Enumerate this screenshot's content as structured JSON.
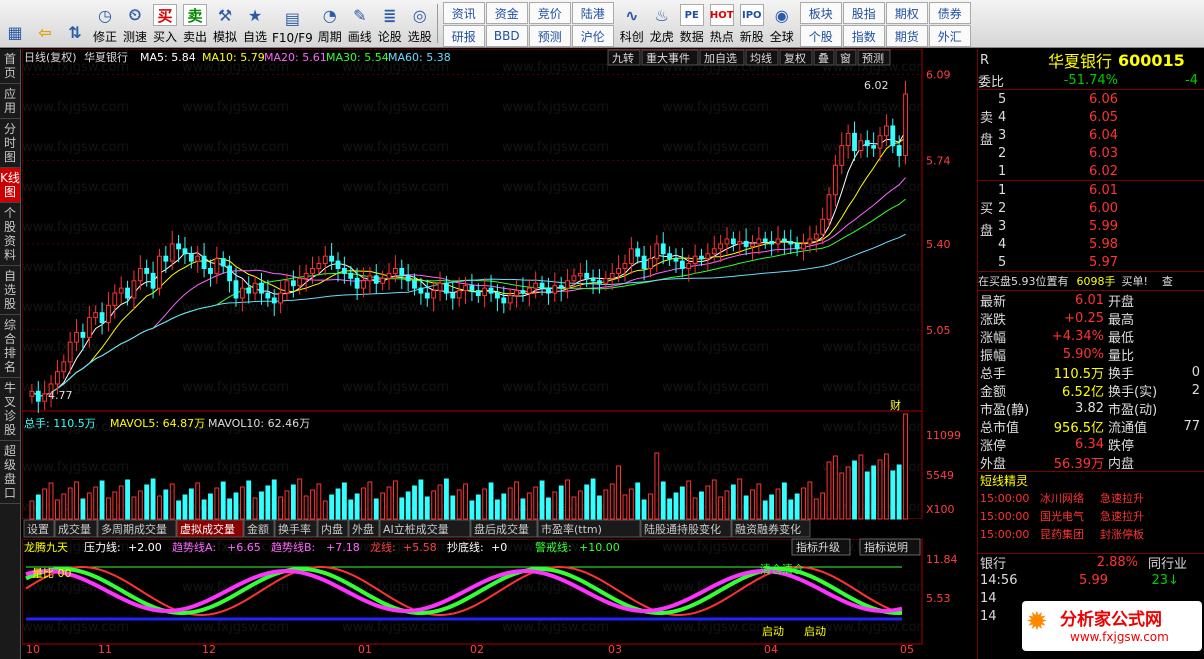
{
  "toolbar": {
    "buttons": [
      {
        "name": "home-button",
        "label": "",
        "icon": "windows-logo-icon"
      },
      {
        "name": "back-button",
        "label": "",
        "icon": "arrow-left-icon"
      },
      {
        "name": "up-down-button",
        "label": "",
        "icon": "updown-icon"
      },
      {
        "name": "fix-button",
        "label": "修正",
        "icon": "clock-icon"
      },
      {
        "name": "test-button",
        "label": "测速",
        "icon": "timer-icon"
      },
      {
        "name": "buy-button",
        "label": "买入",
        "icon": "buy-icon",
        "glyph": "买"
      },
      {
        "name": "sell-button",
        "label": "卖出",
        "icon": "sell-icon",
        "glyph": "卖"
      },
      {
        "name": "simulate-button",
        "label": "模拟",
        "icon": "hammer-icon"
      },
      {
        "name": "watchlist-button",
        "label": "自选",
        "icon": "star-icon"
      },
      {
        "name": "f10-button",
        "label": "F10/F9",
        "icon": "doc-icon"
      },
      {
        "name": "period-button",
        "label": "周期",
        "icon": "cycle-icon"
      },
      {
        "name": "draw-button",
        "label": "画线",
        "icon": "pencil-icon"
      },
      {
        "name": "stock-talk-button",
        "label": "论股",
        "icon": "talk-icon"
      },
      {
        "name": "pick-stock-button",
        "label": "选股",
        "icon": "pick-icon"
      }
    ],
    "grid": [
      "资讯",
      "资金",
      "竞价",
      "陆港",
      "研报",
      "BBD",
      "预测",
      "沪伦"
    ],
    "buttons2": [
      {
        "name": "kegen-button",
        "label": "科创",
        "icon": "chart-icon"
      },
      {
        "name": "dragon-button",
        "label": "龙虎",
        "icon": "dragon-icon"
      },
      {
        "name": "data-button",
        "label": "数据",
        "icon": "pe-icon",
        "glyph": "PE"
      },
      {
        "name": "hot-button",
        "label": "热点",
        "icon": "fire-icon",
        "glyph": "HOT"
      },
      {
        "name": "ipo-button",
        "label": "新股",
        "icon": "ipo-icon",
        "glyph": "IPO"
      },
      {
        "name": "global-button",
        "label": "全球",
        "icon": "globe-icon"
      }
    ],
    "grid3": [
      "板块",
      "股指",
      "期权",
      "债券",
      "个股",
      "指数",
      "期货",
      "外汇"
    ]
  },
  "left_tabs": [
    {
      "label": "首页",
      "active": false
    },
    {
      "label": "应用",
      "active": false
    },
    {
      "label": "分时图",
      "active": false
    },
    {
      "label": "K线图",
      "active": true
    },
    {
      "label": "个股资料",
      "active": false
    },
    {
      "label": "自选股",
      "active": false
    },
    {
      "label": "综合排名",
      "active": false
    },
    {
      "label": "牛叉诊股",
      "active": false
    },
    {
      "label": "超级盘口",
      "active": false
    }
  ],
  "chart_header": {
    "period": "日线(复权)",
    "name": "华夏银行",
    "ma": [
      {
        "label": "MA5: 5.84",
        "color": "#ffffff"
      },
      {
        "label": "MA10: 5.79",
        "color": "#ffff00"
      },
      {
        "label": "MA20: 5.61",
        "color": "#ff66ff"
      },
      {
        "label": "MA30: 5.54",
        "color": "#33ff33"
      },
      {
        "label": "MA60: 5.38",
        "color": "#66ddff"
      }
    ],
    "buttons": [
      "九转",
      "重大事件",
      "加自选",
      "均线",
      "复权",
      "叠",
      "窗",
      "预测"
    ]
  },
  "price_axis": [
    "6.09",
    "5.74",
    "5.40",
    "5.05"
  ],
  "price_labels": {
    "high": "6.02",
    "low": "4.77",
    "fin": "财"
  },
  "volume_header": {
    "total": "总手: 110.5万",
    "mavol5": "MAVOL5: 64.87万",
    "mavol10": "MAVOL10: 62.46万"
  },
  "volume_axis": {
    "top": "11099",
    "mid": "5549",
    "unit": "X100"
  },
  "indicator_tabs": [
    "设置",
    "成交量",
    "多周期成交量",
    "虚拟成交量",
    "金额",
    "换手率",
    "内盘",
    "外盘",
    "AI立桩成交量",
    "盘后成交量",
    "市盈率(ttm)",
    "陆股通持股变化",
    "融资融券变化"
  ],
  "active_indicator": "虚拟成交量",
  "ind_header": {
    "name": "龙腾九天",
    "items": [
      {
        "k": "压力线:",
        "v": "+2.00",
        "c": "#ffffff"
      },
      {
        "k": "趋势线A:",
        "v": "+6.65",
        "c": "#ff66ff"
      },
      {
        "k": "趋势线B:",
        "v": "+7.18",
        "c": "#ff66ff"
      },
      {
        "k": "龙线:",
        "v": "+5.58",
        "c": "#ff4040"
      },
      {
        "k": "抄底线:",
        "v": "+0",
        "c": "#ffffff"
      },
      {
        "k": "警戒线:",
        "v": "+10.00",
        "c": "#33ff33"
      }
    ],
    "btn_upgrade": "指标升级",
    "btn_help": "指标说明"
  },
  "ind_axis": {
    "top": "11.84",
    "mid": "5.53"
  },
  "ind_labels": {
    "vol_ratio": "量比  00",
    "clear": "清仓清仓",
    "start1": "启动",
    "start2": "启动"
  },
  "date_axis": [
    "10",
    "11",
    "12",
    "01",
    "02",
    "03",
    "04",
    "05"
  ],
  "right_panel": {
    "code_prefix": "R",
    "stock_name": "华夏银行",
    "stock_code": "600015",
    "weibi_label": "委比",
    "weibi": "-51.74%",
    "weicha": "-4",
    "sell_label": "卖盘",
    "buy_label": "买盘",
    "sells": [
      {
        "lv": "5",
        "p": "6.06"
      },
      {
        "lv": "4",
        "p": "6.05"
      },
      {
        "lv": "3",
        "p": "6.04"
      },
      {
        "lv": "2",
        "p": "6.03"
      },
      {
        "lv": "1",
        "p": "6.02"
      }
    ],
    "buys": [
      {
        "lv": "1",
        "p": "6.01"
      },
      {
        "lv": "2",
        "p": "6.00"
      },
      {
        "lv": "3",
        "p": "5.99"
      },
      {
        "lv": "4",
        "p": "5.98"
      },
      {
        "lv": "5",
        "p": "5.97"
      }
    ],
    "notice": "在买盘5.93位置有",
    "notice_vol": "6098手",
    "notice_tag": "买单!",
    "notice_more": "查",
    "quotes": [
      {
        "k": "最新",
        "v": "6.01",
        "c": "red",
        "k2": "开盘"
      },
      {
        "k": "涨跌",
        "v": "+0.25",
        "c": "red",
        "k2": "最高"
      },
      {
        "k": "涨幅",
        "v": "+4.34%",
        "c": "red",
        "k2": "最低"
      },
      {
        "k": "振幅",
        "v": "5.90%",
        "c": "red",
        "k2": "量比"
      },
      {
        "k": "总手",
        "v": "110.5万",
        "c": "yel",
        "k2": "换手"
      },
      {
        "k": "金额",
        "v": "6.52亿",
        "c": "yel",
        "k2": "换手(实)"
      },
      {
        "k": "市盈(静)",
        "v": "3.82",
        "c": "wht",
        "k2": "市盈(动)"
      },
      {
        "k": "总市值",
        "v": "956.5亿",
        "c": "yel",
        "k2": "流通值"
      },
      {
        "k": "涨停",
        "v": "6.34",
        "c": "red",
        "k2": "跌停"
      },
      {
        "k": "外盘",
        "v": "56.39万",
        "c": "red",
        "k2": "内盘"
      }
    ],
    "quote_right": [
      "",
      "",
      "",
      "",
      "0",
      "2",
      "",
      "77",
      "",
      ""
    ],
    "elves_title": "短线精灵",
    "elves": [
      {
        "t": "15:00:00",
        "n": "冰川网络",
        "e": "急速拉升"
      },
      {
        "t": "15:00:00",
        "n": "国光电气",
        "e": "急速拉升"
      },
      {
        "t": "15:00:00",
        "n": "昆药集团",
        "e": "封涨停板"
      }
    ],
    "industry": "银行",
    "industry_pct": "2.88%",
    "industry_tab": "同行业",
    "tick": {
      "time": "14:56",
      "price": "5.99",
      "vol": "23"
    },
    "tick_rows": [
      "14",
      "14"
    ],
    "logo_text": "分析家公式网",
    "logo_url": "www.fxjgsw.com"
  },
  "colors": {
    "up": "#ff3333",
    "down": "#33ffff",
    "axis": "#aa0000"
  },
  "chart_data": {
    "type": "candlestick",
    "title": "华夏银行 日线(复权)",
    "dates_axis": [
      "10",
      "11",
      "12",
      "01",
      "02",
      "03",
      "04",
      "05"
    ],
    "y_ticks": [
      6.09,
      5.74,
      5.4,
      5.05
    ],
    "ylim": [
      4.72,
      6.12
    ],
    "max_label": 6.02,
    "min_label": 4.77,
    "closes": [
      4.8,
      4.76,
      4.79,
      4.83,
      4.88,
      4.92,
      5.0,
      5.04,
      5.02,
      5.1,
      5.12,
      5.08,
      5.15,
      5.2,
      5.22,
      5.18,
      5.25,
      5.3,
      5.28,
      5.22,
      5.35,
      5.33,
      5.4,
      5.38,
      5.36,
      5.33,
      5.35,
      5.3,
      5.28,
      5.34,
      5.31,
      5.25,
      5.18,
      5.22,
      5.2,
      5.24,
      5.2,
      5.18,
      5.16,
      5.2,
      5.25,
      5.23,
      5.26,
      5.28,
      5.3,
      5.32,
      5.35,
      5.33,
      5.3,
      5.28,
      5.26,
      5.22,
      5.25,
      5.27,
      5.24,
      5.26,
      5.28,
      5.3,
      5.27,
      5.25,
      5.22,
      5.2,
      5.18,
      5.21,
      5.24,
      5.2,
      5.18,
      5.21,
      5.23,
      5.21,
      5.19,
      5.22,
      5.2,
      5.18,
      5.16,
      5.19,
      5.21,
      5.2,
      5.22,
      5.24,
      5.22,
      5.2,
      5.23,
      5.22,
      5.25,
      5.27,
      5.28,
      5.26,
      5.25,
      5.24,
      5.26,
      5.28,
      5.3,
      5.32,
      5.38,
      5.35,
      5.3,
      5.34,
      5.4,
      5.36,
      5.34,
      5.33,
      5.3,
      5.32,
      5.35,
      5.34,
      5.36,
      5.38,
      5.4,
      5.42,
      5.4,
      5.41,
      5.39,
      5.4,
      5.42,
      5.41,
      5.4,
      5.42,
      5.41,
      5.4,
      5.38,
      5.4,
      5.42,
      5.44,
      5.5,
      5.6,
      5.72,
      5.8,
      5.85,
      5.78,
      5.82,
      5.8,
      5.79,
      5.84,
      5.88,
      5.8,
      5.76,
      6.01
    ],
    "volume_ticks": [
      11099,
      5549
    ]
  }
}
